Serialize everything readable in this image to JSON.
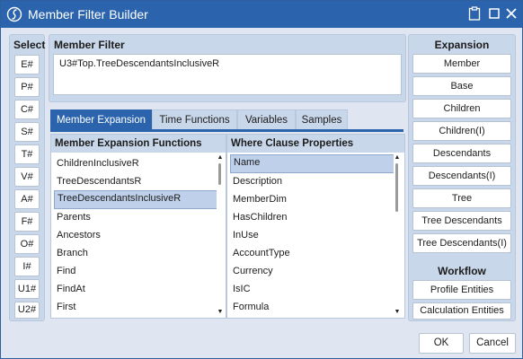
{
  "window": {
    "title": "Member Filter Builder",
    "accent": "#2b64ad"
  },
  "select_panel": {
    "title": "Select",
    "buttons": [
      "E#",
      "P#",
      "C#",
      "S#",
      "T#",
      "V#",
      "A#",
      "F#",
      "O#",
      "I#",
      "U1#",
      "U2#"
    ]
  },
  "member_filter": {
    "title": "Member Filter",
    "value": "U3#Top.TreeDescendantsInclusiveR"
  },
  "tabs": [
    "Member Expansion",
    "Time Functions",
    "Variables",
    "Samples"
  ],
  "active_tab": "Member Expansion",
  "expansion_functions": {
    "header": "Member Expansion Functions",
    "items": [
      "ChildrenInclusiveR",
      "TreeDescendantsR",
      "TreeDescendantsInclusiveR",
      "Parents",
      "Ancestors",
      "Branch",
      "Find",
      "FindAt",
      "First"
    ],
    "selected": "TreeDescendantsInclusiveR"
  },
  "where_clause": {
    "header": "Where Clause Properties",
    "items": [
      "Name",
      "Description",
      "MemberDim",
      "HasChildren",
      "InUse",
      "AccountType",
      "Currency",
      "IsIC",
      "Formula"
    ],
    "selected": "Name"
  },
  "expansion_panel": {
    "title": "Expansion",
    "buttons": [
      "Member",
      "Base",
      "Children",
      "Children(I)",
      "Descendants",
      "Descendants(I)",
      "Tree",
      "Tree Descendants",
      "Tree Descendants(I)"
    ]
  },
  "workflow_panel": {
    "title": "Workflow",
    "buttons": [
      "Profile Entities",
      "Calculation Entities"
    ]
  },
  "dialog_buttons": {
    "ok": "OK",
    "cancel": "Cancel"
  }
}
